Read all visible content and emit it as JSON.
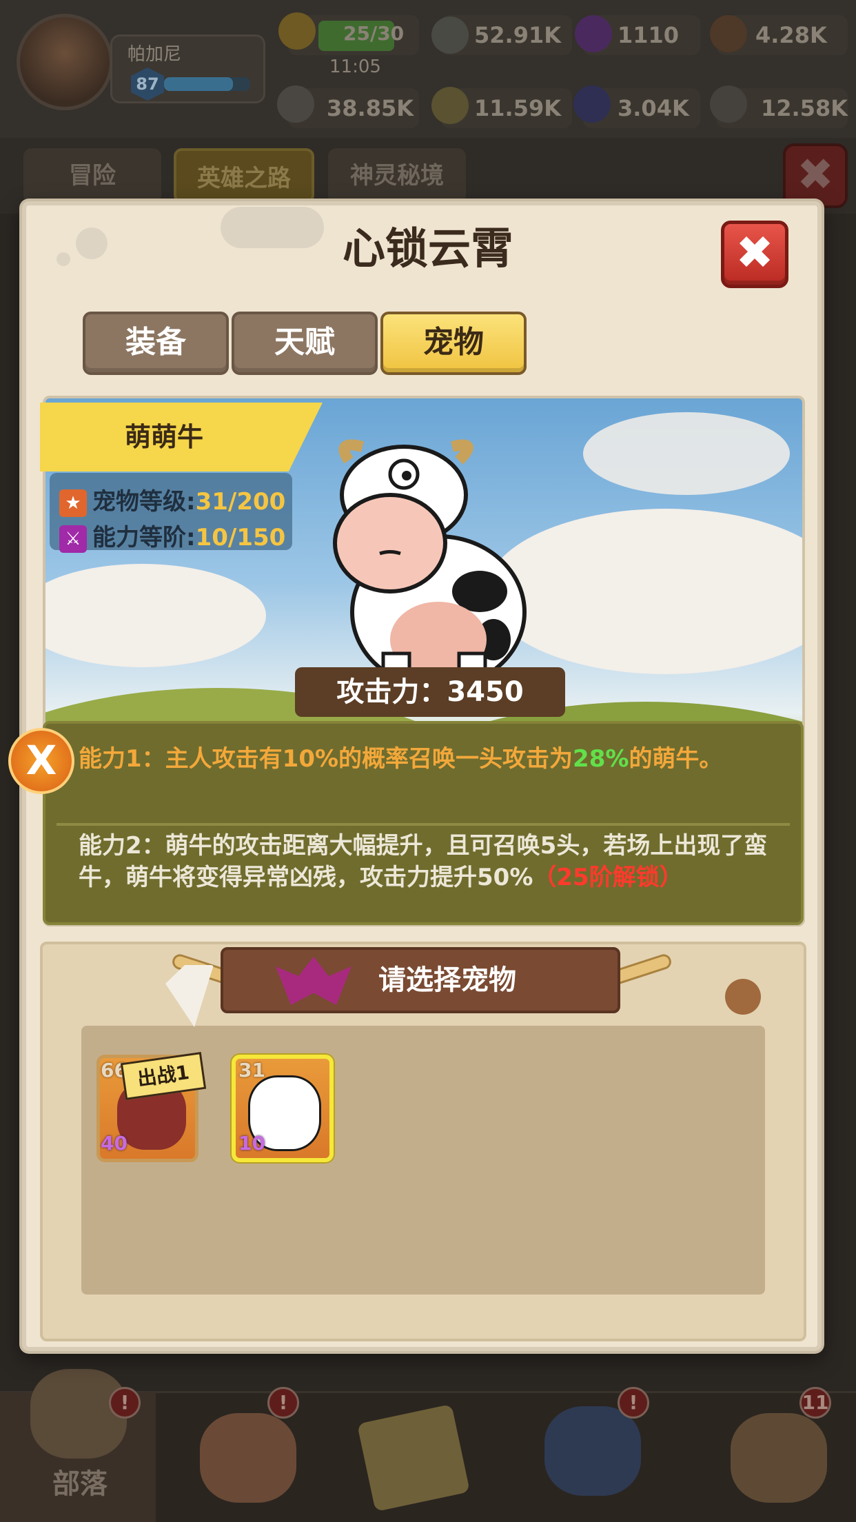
{
  "player": {
    "name": "帕加尼",
    "level": "87"
  },
  "resources": {
    "stamina": "25/30",
    "stamina_timer": "11:05",
    "gems_green": "52.91K",
    "purple_orbs": "1110",
    "wood": "4.28K",
    "bones": "38.85K",
    "coins": "11.59K",
    "crystals": "3.04K",
    "iron": "12.58K"
  },
  "top_tabs": [
    "冒险",
    "英雄之路",
    "神灵秘境"
  ],
  "modal": {
    "title": "心锁云霄",
    "close_icon": "✖",
    "tabs": [
      "装备",
      "天赋",
      "宠物"
    ],
    "active_tab": "宠物"
  },
  "pet": {
    "name": "萌萌牛",
    "level_label": "宠物等级:",
    "level_value": "31/200",
    "rank_label": "能力等阶:",
    "rank_value": "10/150",
    "attack": "攻击力：3450",
    "ability1_a": "能力1：主人攻击有10%的概率召唤一头攻击为",
    "ability1_hl": "28%",
    "ability1_b": "的萌牛。",
    "ability2_a": "能力2：萌牛的攻击距离大幅提升，且可召唤5头，若场上出现了蛮牛，萌牛将变得异常凶残，攻击力提升50%",
    "ability2_lock": "（25阶解锁）",
    "badge_icon": "X"
  },
  "selection": {
    "title": "请选择宠物",
    "cards": [
      {
        "level": "66",
        "rank": "40",
        "tag": "出战1"
      },
      {
        "level": "31",
        "rank": "10"
      }
    ]
  },
  "bottom_nav": {
    "home_label": "部落",
    "badge_alert": "!",
    "badge_count": "11"
  },
  "colors": {
    "accent_yellow": "#f6d64a",
    "close_red": "#d63a30",
    "highlight_green": "#62e04a",
    "lock_red": "#ff3a2c"
  }
}
